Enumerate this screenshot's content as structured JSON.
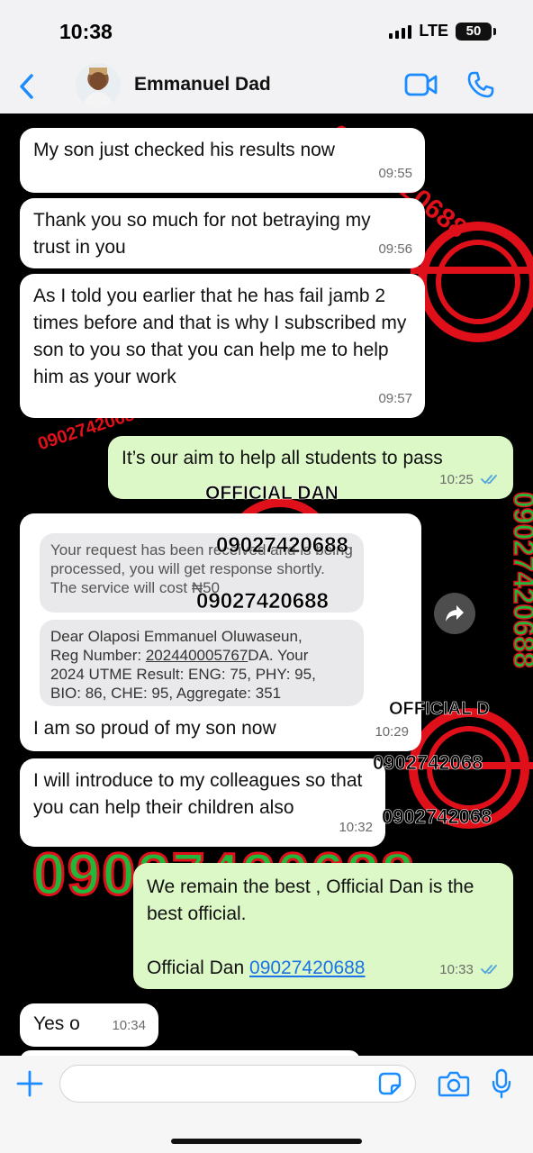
{
  "status_bar": {
    "time": "10:38",
    "network": "LTE",
    "battery": "50"
  },
  "header": {
    "contact_name": "Emmanuel Dad"
  },
  "watermarks": {
    "brand": "OFFICIAL DAN",
    "phone": "09027420688",
    "brand_partial": "OFFICIAL D",
    "phone_partial": "0902742068"
  },
  "messages": [
    {
      "text": "My son just checked his results now",
      "time": "09:55"
    },
    {
      "text": "Thank you so much for not betraying my trust in you",
      "time": "09:56"
    },
    {
      "text": "As I told you earlier that he has fail jamb 2 times before and that is why I subscribed my son to you so that you can help me to help him as your work",
      "time": "09:57"
    },
    {
      "text": "It’s our aim to help all students to pass",
      "time": "10:25"
    },
    {
      "text": "I am so proud of my son now",
      "time": "10:29"
    },
    {
      "text": "I will introduce to my colleagues so that you can help their children also",
      "time": "10:32"
    },
    {
      "line1": "We remain the best , Official Dan is the best official.",
      "line2_prefix": "Official Dan",
      "link": "09027420688",
      "time": "10:33"
    },
    {
      "text": "Yes o",
      "time": "10:34"
    }
  ],
  "sms_screenshot": {
    "sms1": "Your request has been received and is being processed, you will get response shortly. The service will cost ₦50",
    "sms2_line1": "Dear Olaposi Emmanuel Oluwaseun,",
    "sms2_reg_prefix": "Reg Number: ",
    "sms2_reg_number": "202440005767",
    "sms2_reg_suffix": "DA. Your",
    "sms2_line3": "2024 UTME Result: ENG: 75, PHY: 95,",
    "sms2_line4": "BIO: 86, CHE: 95, Aggregate: 351"
  },
  "input": {
    "placeholder": ""
  },
  "colors": {
    "incoming": "#ffffff",
    "outgoing": "#dcf8c6",
    "read_ticks": "#4fa3e0",
    "watermark_red": "#e0101a",
    "watermark_green": "#1fb83a"
  }
}
